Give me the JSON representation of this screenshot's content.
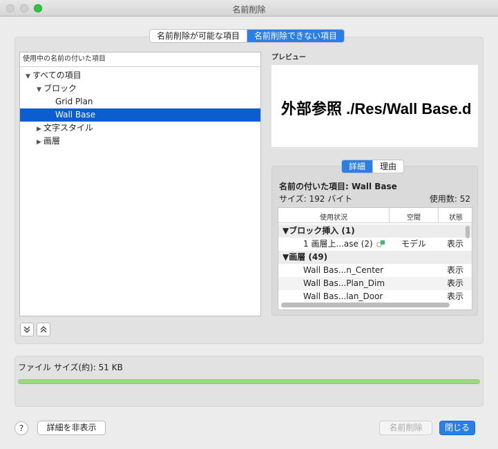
{
  "window": {
    "title": "名前削除"
  },
  "main_tabs": [
    {
      "label": "名前削除が可能な項目",
      "active": false
    },
    {
      "label": "名前削除できない項目",
      "active": true
    }
  ],
  "tree": {
    "header": "使用中の名前の付いた項目",
    "items": [
      {
        "label": "すべての項目",
        "arrow": "▼"
      },
      {
        "label": "ブロック",
        "arrow": "▼"
      },
      {
        "label": "Grid Plan",
        "arrow": ""
      },
      {
        "label": "Wall Base",
        "arrow": "",
        "selected": true
      },
      {
        "label": "文字スタイル",
        "arrow": "▶"
      },
      {
        "label": "画層",
        "arrow": "▶"
      }
    ]
  },
  "preview": {
    "label": "プレビュー",
    "text": "外部参照 ./Res/Wall Base.d"
  },
  "detail_tabs": [
    {
      "label": "詳細",
      "active": true
    },
    {
      "label": "理由",
      "active": false
    }
  ],
  "details": {
    "name_line": "名前の付いた項目: Wall Base",
    "size_line": "サイズ: 192 バイト",
    "count_line": "使用数: 52",
    "columns": [
      "使用状況",
      "空間",
      "状態"
    ],
    "groups": [
      {
        "label": "▼ブロック挿入 (1)",
        "rows": [
          {
            "name": "1 画層上...ase (2)",
            "space": "モデル",
            "state": "表示"
          }
        ]
      },
      {
        "label": "▼画層 (49)",
        "rows": [
          {
            "name": "Wall Bas...n_Center",
            "space": "",
            "state": "表示"
          },
          {
            "name": "Wall Bas...Plan_Dim",
            "space": "",
            "state": "表示"
          },
          {
            "name": "Wall Bas...lan_Door",
            "space": "",
            "state": "表示"
          }
        ]
      }
    ]
  },
  "file": {
    "label": "ファイル サイズ(約): 51 KB",
    "progress": 1.0
  },
  "buttons": {
    "help": "?",
    "hide_details": "詳細を非表示",
    "purge": "名前削除",
    "close": "閉じる"
  },
  "colors": {
    "accent": "#2a7ee6",
    "selection": "#0b5dd0",
    "progress": "#9fd97c"
  }
}
